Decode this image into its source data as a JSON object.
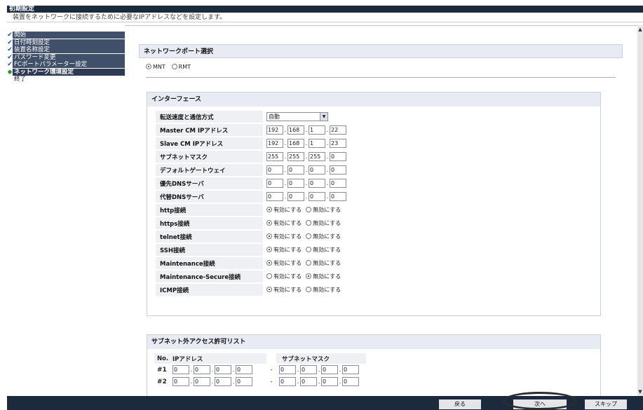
{
  "window": {
    "title": "初期設定"
  },
  "subtitle": "装置をネットワークに接続するために必要なIPアドレスなどを設定します。",
  "sidebar": {
    "items": [
      {
        "label": "開始",
        "done": true
      },
      {
        "label": "日付時刻設定",
        "done": true
      },
      {
        "label": "装置名称設定",
        "done": true
      },
      {
        "label": "パスワード変更",
        "done": true
      },
      {
        "label": "FCポートパラメーター設定",
        "done": true
      },
      {
        "label": "ネットワーク環境設定",
        "current": true
      },
      {
        "label": "終了"
      }
    ],
    "check_glyph": "✔",
    "current_glyph": "◆"
  },
  "port_select": {
    "header": "ネットワークポート選択",
    "options": [
      "MNT",
      "RMT"
    ],
    "selected": "MNT"
  },
  "interface": {
    "header": "インターフェース",
    "speed": {
      "label": "転送速度と通信方式",
      "value": "自動"
    },
    "master_ip": {
      "label": "Master CM IPアドレス",
      "octets": [
        "192",
        "168",
        "1",
        "22"
      ]
    },
    "slave_ip": {
      "label": "Slave CM IPアドレス",
      "octets": [
        "192",
        "168",
        "1",
        "23"
      ]
    },
    "subnet": {
      "label": "サブネットマスク",
      "octets": [
        "255",
        "255",
        "255",
        "0"
      ]
    },
    "gateway": {
      "label": "デフォルトゲートウェイ",
      "octets": [
        "0",
        "0",
        "0",
        "0"
      ]
    },
    "dns_primary": {
      "label": "優先DNSサーバ",
      "octets": [
        "0",
        "0",
        "0",
        "0"
      ]
    },
    "dns_alt": {
      "label": "代替DNSサーバ",
      "octets": [
        "0",
        "0",
        "0",
        "0"
      ]
    },
    "enable_label": "有効にする",
    "disable_label": "無効にする",
    "toggles": [
      {
        "label": "http接続",
        "enabled": true
      },
      {
        "label": "https接続",
        "enabled": true
      },
      {
        "label": "telnet接続",
        "enabled": true
      },
      {
        "label": "SSH接続",
        "enabled": true
      },
      {
        "label": "Maintenance接続",
        "enabled": true
      },
      {
        "label": "Maintenance-Secure接続",
        "enabled": false
      },
      {
        "label": "ICMP接続",
        "enabled": true
      }
    ]
  },
  "subnet_access": {
    "header": "サブネット外アクセス許可リスト",
    "col_no": "No.",
    "col_ip": "IPアドレス",
    "col_mask": "サブネットマスク",
    "separator": "-",
    "rows": [
      {
        "no": "#1",
        "ip": [
          "0",
          "0",
          "0",
          "0"
        ],
        "mask": [
          "0",
          "0",
          "0",
          "0"
        ]
      },
      {
        "no": "#2",
        "ip": [
          "0",
          "0",
          "0",
          "0"
        ],
        "mask": [
          "0",
          "0",
          "0",
          "0"
        ]
      }
    ]
  },
  "footer": {
    "back": "戻る",
    "next": "次へ",
    "skip": "スキップ"
  },
  "scroll": {
    "up_glyph": "▲",
    "down_glyph": "▼"
  },
  "dropdown_glyph": "▼"
}
